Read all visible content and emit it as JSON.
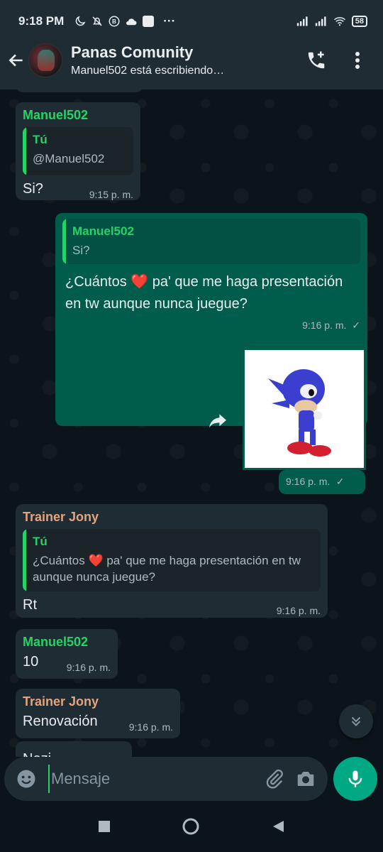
{
  "status": {
    "time": "9:18 PM",
    "battery": "58",
    "overflow": "···"
  },
  "header": {
    "title": "Panas Comunity",
    "subtitle": "Manuel502 está escribiendo…"
  },
  "messages": [
    {
      "sender": "Manuel502",
      "quote_author": "Tú",
      "quote_text": "@Manuel502",
      "text": "Si?",
      "time": "9:15 p. m."
    },
    {
      "quote_author": "Manuel502",
      "quote_text": "Si?",
      "text_before": "¿Cuántos ",
      "emoji": "❤️",
      "text_after": " pa' que me haga presentación en tw aunque nunca juegue?",
      "time": "9:16 p. m.",
      "check": "✓"
    },
    {
      "time": "9:16 p. m.",
      "check": "✓"
    },
    {
      "sender": "Trainer Jony",
      "quote_author": "Tú",
      "quote_before": "¿Cuántos ",
      "quote_emoji": "❤️",
      "quote_after": " pa' que me haga presentación en tw aunque nunca juegue?",
      "text": "Rt",
      "time": "9:16 p. m."
    },
    {
      "sender": "Manuel502",
      "text": "10",
      "time": "9:16 p. m."
    },
    {
      "sender": "Trainer Jony",
      "text": "Renovación",
      "time": "9:16 p. m."
    },
    {
      "text": "Nezi"
    }
  ],
  "input": {
    "placeholder": "Mensaje"
  },
  "colors": {
    "accent": "#25d366",
    "outgoing": "#005c4b",
    "incoming": "#202c33",
    "header": "#1f2c34",
    "mic": "#00a884"
  }
}
